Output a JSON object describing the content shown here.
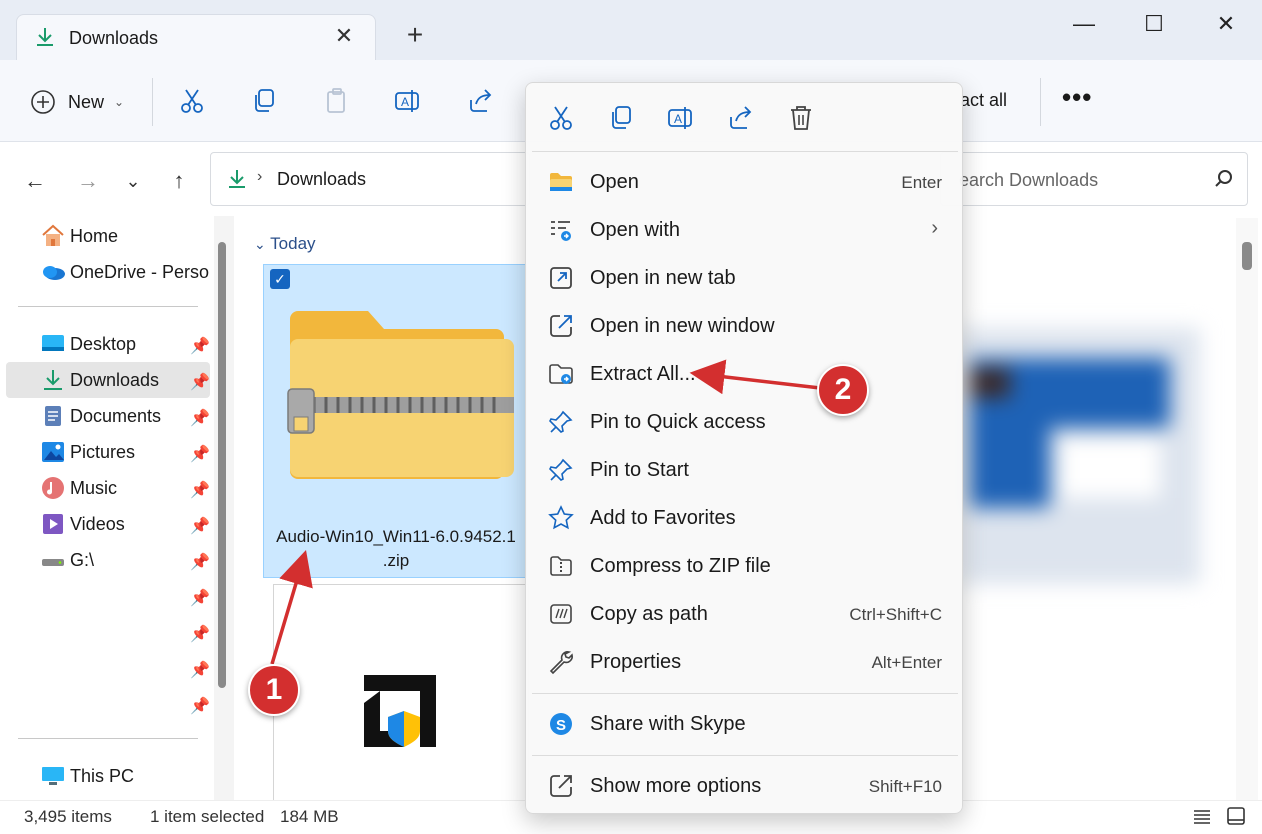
{
  "window": {
    "tab_title": "Downloads",
    "tab_close": "✕",
    "new_tab": "+",
    "minimize": "—",
    "maximize": "☐",
    "close": "✕"
  },
  "toolbar": {
    "new_label": "New",
    "extract_all_label": "act all",
    "more_label": "•••"
  },
  "nav": {
    "address_folder": "Downloads",
    "search_placeholder": "earch Downloads"
  },
  "sidebar": {
    "items": [
      {
        "label": "Home",
        "icon": "home-icon"
      },
      {
        "label": "OneDrive - Persor",
        "icon": "onedrive-icon"
      },
      {
        "label": "Desktop",
        "icon": "desktop-icon",
        "pinned": true
      },
      {
        "label": "Downloads",
        "icon": "downloads-icon",
        "pinned": true,
        "selected": true
      },
      {
        "label": "Documents",
        "icon": "documents-icon",
        "pinned": true
      },
      {
        "label": "Pictures",
        "icon": "pictures-icon",
        "pinned": true
      },
      {
        "label": "Music",
        "icon": "music-icon",
        "pinned": true
      },
      {
        "label": "Videos",
        "icon": "videos-icon",
        "pinned": true
      },
      {
        "label": "G:\\",
        "icon": "drive-icon",
        "pinned": true
      },
      {
        "label": "This PC",
        "icon": "this-pc-icon"
      }
    ]
  },
  "content": {
    "group_header": "Today",
    "files": [
      {
        "name_line1": "Audio-Win10_Win11-6.0.9452.1",
        "name_line2": ".zip",
        "selected": true
      }
    ]
  },
  "status": {
    "item_count": "3,495 items",
    "selection": "1 item selected",
    "size": "184 MB"
  },
  "context_menu": {
    "top_icons": [
      "cut-icon",
      "copy-icon",
      "rename-icon",
      "share-icon",
      "delete-icon"
    ],
    "items": [
      {
        "label": "Open",
        "shortcut": "Enter",
        "icon": "folder-open-icon"
      },
      {
        "label": "Open with",
        "shortcut": "",
        "icon": "open-with-icon",
        "submenu": "›"
      },
      {
        "label": "Open in new tab",
        "shortcut": "",
        "icon": "new-tab-icon"
      },
      {
        "label": "Open in new window",
        "shortcut": "",
        "icon": "new-window-icon"
      },
      {
        "label": "Extract All...",
        "shortcut": "",
        "icon": "extract-icon"
      },
      {
        "label": "Pin to Quick access",
        "shortcut": "",
        "icon": "pin-icon"
      },
      {
        "label": "Pin to Start",
        "shortcut": "",
        "icon": "pin-start-icon"
      },
      {
        "label": "Add to Favorites",
        "shortcut": "",
        "icon": "star-icon"
      },
      {
        "label": "Compress to ZIP file",
        "shortcut": "",
        "icon": "zip-icon"
      },
      {
        "label": "Copy as path",
        "shortcut": "Ctrl+Shift+C",
        "icon": "copy-path-icon"
      },
      {
        "label": "Properties",
        "shortcut": "Alt+Enter",
        "icon": "wrench-icon"
      },
      {
        "label": "Share with Skype",
        "shortcut": "",
        "icon": "skype-icon"
      },
      {
        "label": "Show more options",
        "shortcut": "Shift+F10",
        "icon": "more-options-icon"
      }
    ]
  },
  "annotations": {
    "marker1": "1",
    "marker2": "2",
    "color": "#d32f2f"
  }
}
